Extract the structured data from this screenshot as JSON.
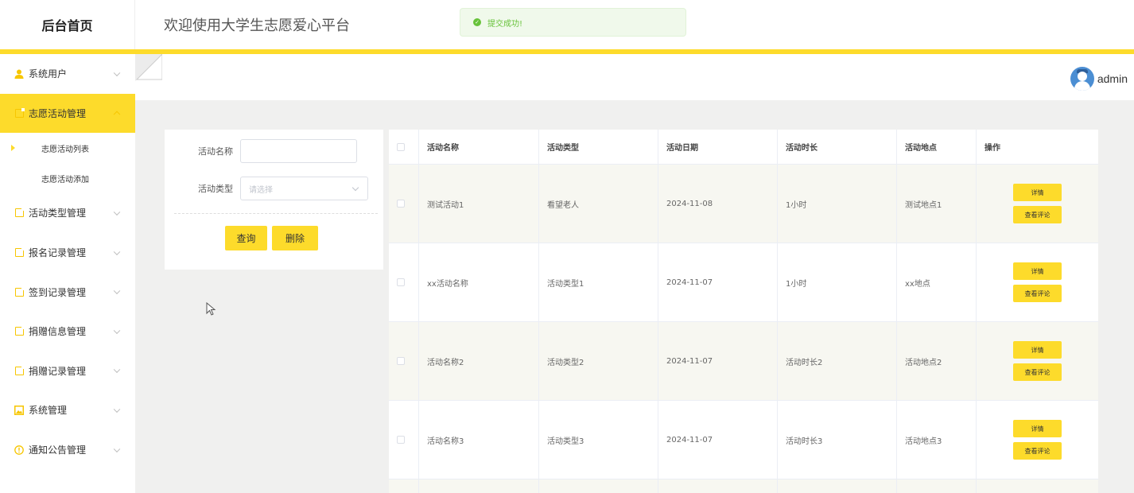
{
  "header": {
    "brand": "后台首页",
    "site_title": "欢迎使用大学生志愿爱心平台",
    "toast": "提交成功!"
  },
  "user": {
    "name": "admin"
  },
  "sidebar": {
    "items": [
      {
        "label": "系统用户",
        "icon": "user-icon"
      },
      {
        "label": "志愿活动管理",
        "icon": "document-icon",
        "active": true,
        "children": [
          {
            "label": "志愿活动列表",
            "selected": true
          },
          {
            "label": "志愿活动添加"
          }
        ]
      },
      {
        "label": "活动类型管理",
        "icon": "document-icon"
      },
      {
        "label": "报名记录管理",
        "icon": "document-icon"
      },
      {
        "label": "签到记录管理",
        "icon": "document-icon"
      },
      {
        "label": "捐赠信息管理",
        "icon": "document-icon"
      },
      {
        "label": "捐赠记录管理",
        "icon": "document-icon"
      },
      {
        "label": "系统管理",
        "icon": "image-icon"
      },
      {
        "label": "通知公告管理",
        "icon": "info-icon"
      }
    ]
  },
  "search": {
    "name_label": "活动名称",
    "name_value": "",
    "type_label": "活动类型",
    "type_placeholder": "请选择",
    "query_button": "查询",
    "delete_button": "删除"
  },
  "table": {
    "columns": [
      "活动名称",
      "活动类型",
      "活动日期",
      "活动时长",
      "活动地点",
      "操作"
    ],
    "rows": [
      [
        "测试活动1",
        "看望老人",
        "2024-11-08",
        "1小时",
        "测试地点1"
      ],
      [
        "xx活动名称",
        "活动类型1",
        "2024-11-07",
        "1小时",
        "xx地点"
      ],
      [
        "活动名称2",
        "活动类型2",
        "2024-11-07",
        "活动时长2",
        "活动地点2"
      ],
      [
        "活动名称3",
        "活动类型3",
        "2024-11-07",
        "活动时长3",
        "活动地点3"
      ]
    ],
    "actions": {
      "detail": "详情",
      "comments": "查看评论"
    }
  },
  "colors": {
    "accent": "#fddb2b",
    "success": "#67c23a"
  }
}
